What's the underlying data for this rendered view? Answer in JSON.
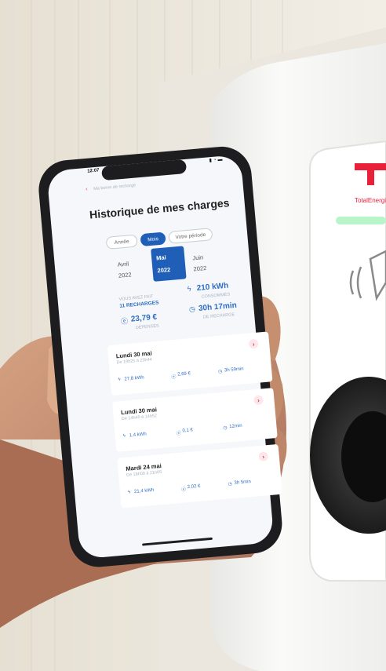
{
  "photo": {
    "background": "#f1ede4",
    "wall": "#e9e4d8",
    "charger": "#f4f4f2",
    "charger_shadow": "#d9d9d6",
    "hand": "#c99574",
    "phone_frame": "#1d1d1f",
    "screen_bg": "#f6f7fa"
  },
  "charger": {
    "brand": "TotalEnergies",
    "brand_color": "#e8203a",
    "led_color": "#b8f5c8",
    "nfc_icon": "contactless-icon"
  },
  "status_bar": {
    "time": "12:07",
    "icons": [
      "signal-icon",
      "wifi-icon",
      "battery-icon"
    ]
  },
  "header": {
    "back_label": "Ma borne de recharge",
    "title": "Historique de mes charges"
  },
  "period_tabs": [
    {
      "label": "Année",
      "active": false
    },
    {
      "label": "Mois",
      "active": true
    },
    {
      "label": "Votre période",
      "active": false
    }
  ],
  "months": [
    {
      "month": "Avril",
      "year": "2022",
      "active": false
    },
    {
      "month": "Mai",
      "year": "2022",
      "active": true
    },
    {
      "month": "Juin",
      "year": "2022",
      "active": false
    }
  ],
  "summary": {
    "intro": "VOUS AVEZ FAIT",
    "count": "11 RECHARGES",
    "energy": "210 kWh",
    "energy_label": "CONSOMMÉS",
    "cost": "23,79 €",
    "cost_label": "DÉPENSÉS",
    "duration": "30h 17min",
    "duration_label": "DE RECHARGE"
  },
  "charges": [
    {
      "date": "Lundi 30 mai",
      "sub": "De 19h25 à 23h44",
      "energy": "27,8 kWh",
      "cost": "2,69 €",
      "duration": "3h 59min"
    },
    {
      "date": "Lundi 30 mai",
      "sub": "De 14h40 à 14h52",
      "energy": "1,4 kWh",
      "cost": "0,1 €",
      "duration": "12min"
    },
    {
      "date": "Mardi 24 mai",
      "sub": "De 18h00 à 21h05",
      "energy": "21,4 kWh",
      "cost": "2,02 €",
      "duration": "3h 5min"
    }
  ]
}
